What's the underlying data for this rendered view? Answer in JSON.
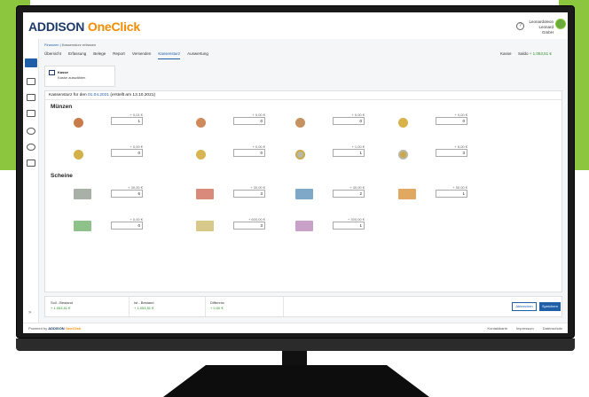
{
  "brand": {
    "name": "ADDISON",
    "suffix": "OneClick"
  },
  "user": {
    "name": "Leonardoleon",
    "company": "Leonard GmbH"
  },
  "breadcrumb": {
    "root": "Finanzen",
    "separator": "|",
    "current": "Kassensturz erfassen"
  },
  "tabs": [
    {
      "label": "Übersicht",
      "active": false
    },
    {
      "label": "Erfassung",
      "active": false
    },
    {
      "label": "Belege",
      "active": false
    },
    {
      "label": "Report",
      "active": false
    },
    {
      "label": "Versenden",
      "active": false
    },
    {
      "label": "Kassensturz",
      "active": true
    },
    {
      "label": "Auswertung",
      "active": false
    }
  ],
  "header_right": {
    "kasse": "Kasse",
    "saldo_label": "Saldo",
    "saldo_value": "+ 1.053,51 €"
  },
  "kasse_card": {
    "title": "Kasse",
    "subtitle": "Kasse auswählen"
  },
  "content": {
    "heading_prefix": "Kassensturz für den",
    "heading_date": "01.04.2021",
    "heading_suffix": "(erstellt am 13.10.2021)"
  },
  "muenzen": {
    "title": "Münzen",
    "items": [
      {
        "denom": "+ 0,01 €",
        "qty": "1"
      },
      {
        "denom": "+ 0,00 €",
        "qty": "0"
      },
      {
        "denom": "+ 0,00 €",
        "qty": "0"
      },
      {
        "denom": "+ 0,00 €",
        "qty": "0"
      },
      {
        "denom": "+ 0,00 €",
        "qty": "0"
      },
      {
        "denom": "+ 0,00 €",
        "qty": "0"
      },
      {
        "denom": "+ 1,00 €",
        "qty": "1"
      },
      {
        "denom": "+ 6,00 €",
        "qty": "3"
      }
    ]
  },
  "scheine": {
    "title": "Scheine",
    "items": [
      {
        "denom": "+ 30,00 €",
        "qty": "6"
      },
      {
        "denom": "+ 30,00 €",
        "qty": "3"
      },
      {
        "denom": "+ 40,00 €",
        "qty": "2"
      },
      {
        "denom": "+ 50,00 €",
        "qty": "1"
      },
      {
        "denom": "+ 0,00 €",
        "qty": "0"
      },
      {
        "denom": "+ 600,00 €",
        "qty": "3"
      },
      {
        "denom": "+ 300,00 €",
        "qty": "1"
      }
    ]
  },
  "totals": {
    "soll_label": "Soll - Bestand",
    "soll_value": "+ 1.053,51 €",
    "ist_label": "Ist - Bestand",
    "ist_value": "+ 1.053,51 €",
    "diff_label": "Differenz",
    "diff_value": "+ 0,00 €"
  },
  "buttons": {
    "cancel": "Abbrechen",
    "save": "Speichern"
  },
  "footer": {
    "powered_by": "Powered by",
    "brand": "ADDISON",
    "brand_suffix": "OneClick",
    "links": [
      "Kontaktkarte",
      "Impressum",
      "Datenschutz"
    ]
  },
  "colors": {
    "brand_blue": "#1e3a6b",
    "brand_orange": "#f28c00",
    "accent_blue": "#1e5fa8",
    "positive_green": "#2a8f2a",
    "background_green": "#8cc63f"
  }
}
